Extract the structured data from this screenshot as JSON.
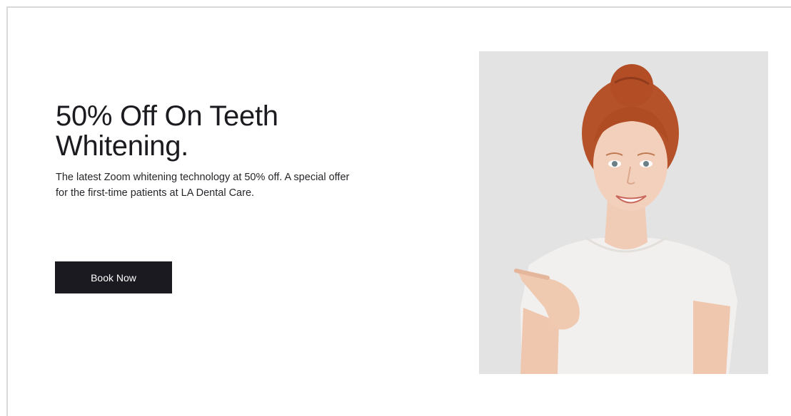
{
  "hero": {
    "title": "50% Off On Teeth Whitening.",
    "description": "The latest Zoom whitening technology at 50% off. A special offer for the first-time patients at LA Dental Care.",
    "button_label": "Book Now"
  },
  "colors": {
    "button_bg": "#1a1a20",
    "button_text": "#ffffff",
    "title_text": "#1b1b1f",
    "photo_bg": "#e3e3e3"
  }
}
